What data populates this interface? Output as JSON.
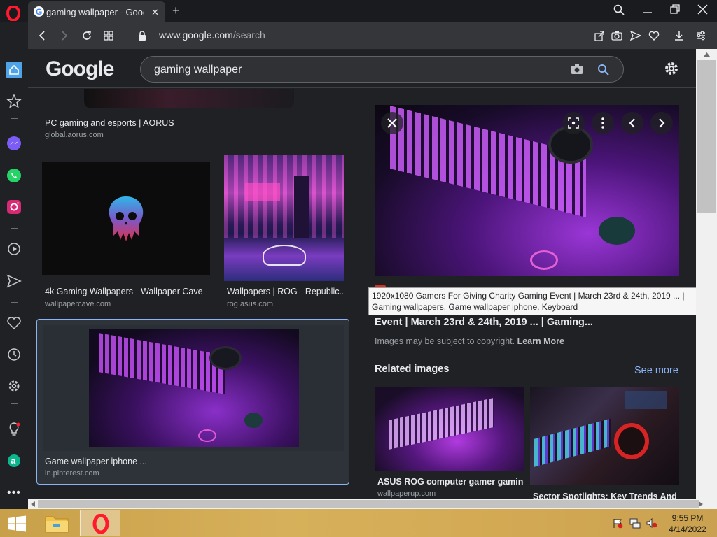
{
  "tab": {
    "title": "gaming wallpaper - Google"
  },
  "address": {
    "host": "www.google.com",
    "path": "/search"
  },
  "google": {
    "logo": "Google",
    "query": "gaming wallpaper"
  },
  "results": [
    {
      "caption": "PC gaming and esports | AORUS",
      "source": "global.aorus.com"
    },
    {
      "caption": "4k Gaming Wallpapers - Wallpaper Cave",
      "source": "wallpapercave.com"
    },
    {
      "caption": "Wallpapers | ROG - Republic...",
      "source": "rog.asus.com"
    },
    {
      "caption": "Game wallpaper iphone ...",
      "source": "in.pinterest.com"
    }
  ],
  "panel": {
    "tooltip": "1920x1080 Gamers For Giving Charity Gaming Event | March 23rd & 24th, 2019  ... | Gaming wallpapers, Game wallpaper iphone, Keyboard",
    "title_tail": "Event | March 23rd & 24th, 2019 ... | Gaming...",
    "copyright": "Images may be subject to copyright.",
    "learn_more": "Learn More",
    "related_heading": "Related images",
    "see_more": "See more",
    "related": [
      {
        "caption": "ASUS ROG computer gamer gaming...",
        "source": "wallpaperup.com"
      },
      {
        "caption": "Sector Spotlights: Key Trends And ...",
        "source": ""
      }
    ]
  },
  "taskbar": {
    "time": "9:55 PM",
    "date": "4/14/2022"
  },
  "colors": {
    "accent_blue": "#8ab4f8",
    "opera_red": "#ff1b2d",
    "panel_bg": "#202124"
  }
}
